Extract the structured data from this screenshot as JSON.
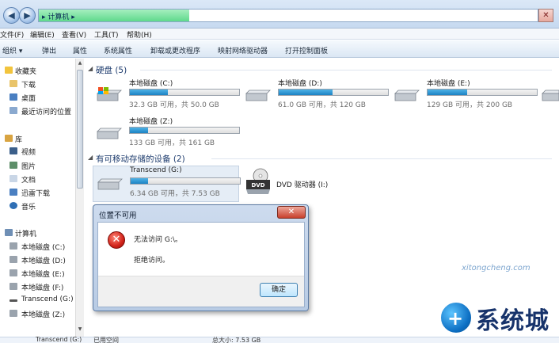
{
  "address": {
    "path": "▸ 计算机 ▸"
  },
  "menu": [
    "文件(F)",
    "编辑(E)",
    "查看(V)",
    "工具(T)",
    "帮助(H)"
  ],
  "toolbar": [
    "组织 ▾",
    "弹出",
    "属性",
    "系统属性",
    "卸载或更改程序",
    "映射网络驱动器",
    "打开控制面板"
  ],
  "nav": {
    "favorites_title": "收藏夹",
    "favorites": [
      "下载",
      "桌面",
      "最近访问的位置"
    ],
    "libraries_title": "库",
    "libraries": [
      "视频",
      "图片",
      "文档",
      "迅雷下载",
      "音乐"
    ],
    "computer_title": "计算机",
    "computer": [
      "本地磁盘 (C:)",
      "本地磁盘 (D:)",
      "本地磁盘 (E:)",
      "本地磁盘 (F:)",
      "Transcend (G:)",
      "本地磁盘 (Z:)"
    ]
  },
  "sections": {
    "hard_disks": "硬盘 (5)",
    "removable": "有可移动存储的设备 (2)"
  },
  "drives": [
    {
      "name": "本地磁盘 (C:)",
      "info": "32.3 GB 可用，共 50.0 GB",
      "used_fraction": 0.35
    },
    {
      "name": "本地磁盘 (D:)",
      "info": "61.0 GB 可用，共 120 GB",
      "used_fraction": 0.49
    },
    {
      "name": "本地磁盘 (E:)",
      "info": "129 GB 可用，共 200 GB",
      "used_fraction": 0.36
    },
    {
      "name": "本地磁盘 (Z:)",
      "info": "133 GB 可用，共 161 GB",
      "used_fraction": 0.17
    }
  ],
  "removable_drive": {
    "name": "Transcend (G:)",
    "info": "6.34 GB 可用，共 7.53 GB",
    "used_fraction": 0.16
  },
  "dvd": {
    "name": "DVD 驱动器 (I:)",
    "label": "DVD"
  },
  "dialog": {
    "title": "位置不可用",
    "close": "✕",
    "message1": "无法访问 G:\\。",
    "message2": "拒绝访问。",
    "ok": "确定"
  },
  "details": {
    "name": "Transcend (G:)",
    "used": "已用空间",
    "total": "总大小: 7.53 GB"
  },
  "watermark": {
    "site": "xitongcheng.com",
    "brand": "系统城"
  },
  "colors": {
    "bar_fill": "#1c83c4",
    "error_red": "#d2231a"
  }
}
